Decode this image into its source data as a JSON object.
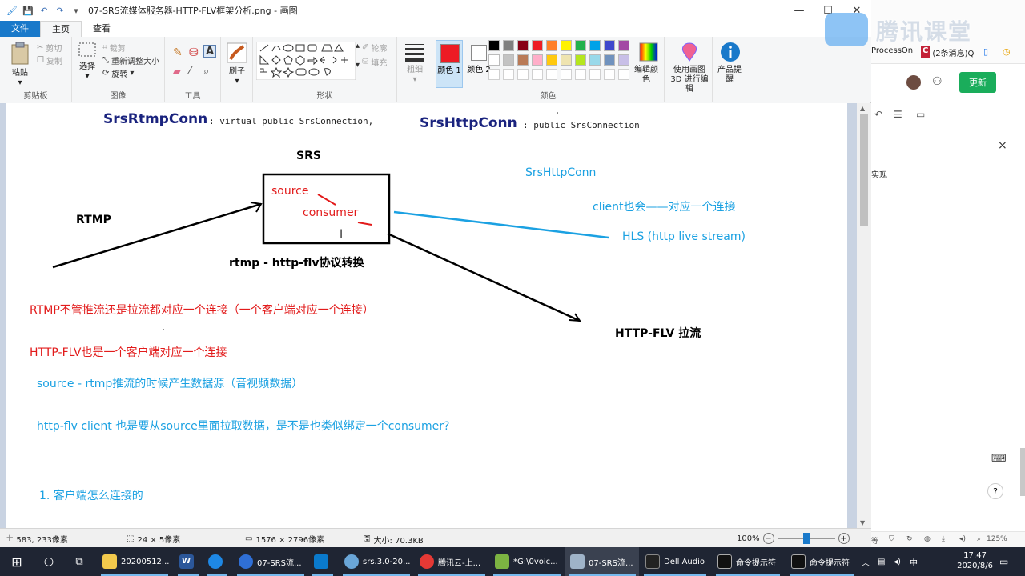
{
  "window": {
    "title": "07-SRS流媒体服务器-HTTP-FLV框架分析.png - 画图",
    "controls": {
      "minimize": "—",
      "maximize": "☐",
      "close": "✕"
    }
  },
  "tabs": [
    {
      "label": "文件"
    },
    {
      "label": "主页"
    },
    {
      "label": "查看"
    }
  ],
  "ribbon": {
    "clipboard": {
      "paste": "粘贴",
      "cut": "剪切",
      "copy": "复制",
      "label": "剪贴板"
    },
    "image": {
      "select": "选择",
      "crop": "裁剪",
      "resize": "重新调整大小",
      "rotate": "旋转",
      "label": "图像"
    },
    "tools": {
      "label": "工具"
    },
    "brushes": {
      "label": "刷子"
    },
    "shapes": {
      "outline": "轮廓",
      "fill": "填充",
      "label": "形状"
    },
    "size": {
      "label": "粗细"
    },
    "colors": {
      "color1": "颜色 1",
      "color2": "颜色 2",
      "edit": "编辑颜色",
      "label": "颜色",
      "palette_row1": [
        "#000000",
        "#7f7f7f",
        "#880015",
        "#ed1c24",
        "#ff7f27",
        "#fff200",
        "#22b14c",
        "#00a2e8",
        "#3f48cc",
        "#a349a4"
      ],
      "palette_row2": [
        "#ffffff",
        "#c3c3c3",
        "#b97a57",
        "#ffaec9",
        "#ffc90e",
        "#efe4b0",
        "#b5e61d",
        "#99d9ea",
        "#7092be",
        "#c8bfe7"
      ]
    },
    "paint3d": "使用画图 3D 进行编辑",
    "product": "产品提醒"
  },
  "canvas": {
    "srs_rtmp_conn": "SrsRtmpConn",
    "srs_rtmp_conn_decl": ": virtual public SrsConnection,",
    "srs_http_conn": "SrsHttpConn",
    "srs_http_conn_decl": ": public SrsConnection",
    "srs_label": "SRS",
    "source_label": "source",
    "consumer_label": "consumer",
    "rtmp_label": "RTMP",
    "protocol_convert": "rtmp - http-flv协议转换",
    "http_flv_pull": "HTTP-FLV 拉流",
    "srs_http_conn_blue": "SrsHttpConn",
    "client_note": "client也会——对应一个连接",
    "hls_note": "HLS (http live stream)",
    "rtmp_note": "RTMP不管推流还是拉流都对应一个连接（一个客户端对应一个连接）",
    "httpflv_note": "HTTP-FLV也是一个客户端对应一个连接",
    "source_note": "source  -  rtmp推流的时候产生数据源（音视频数据）",
    "question_note": "http-flv client 也是要从source里面拉取数据，是不是也类似绑定一个consumer?",
    "list_item": "1. 客户端怎么连接的"
  },
  "statusbar": {
    "cursor_pos": "583, 233像素",
    "selection_size": "24 × 5像素",
    "image_size": "1576 × 2796像素",
    "file_size": "大小: 70.3KB",
    "zoom": "100%"
  },
  "right_panel": {
    "brand": "腾讯课堂",
    "processon": "ProcessOn",
    "csdn": "(2条消息)Q",
    "update": "更新",
    "side_text": "实现",
    "close": "×",
    "zoom": "125%"
  },
  "taskbar": {
    "items": [
      {
        "label": "20200512..."
      },
      {
        "label": ""
      },
      {
        "label": ""
      },
      {
        "label": "07-SRS流..."
      },
      {
        "label": ""
      },
      {
        "label": "srs.3.0-20..."
      },
      {
        "label": "腾讯云-上..."
      },
      {
        "label": "*G:\\0voic..."
      },
      {
        "label": "07-SRS流..."
      },
      {
        "label": "Dell Audio"
      },
      {
        "label": "命令提示符"
      },
      {
        "label": "命令提示符"
      }
    ],
    "time": "17:47",
    "date": "2020/8/6"
  }
}
